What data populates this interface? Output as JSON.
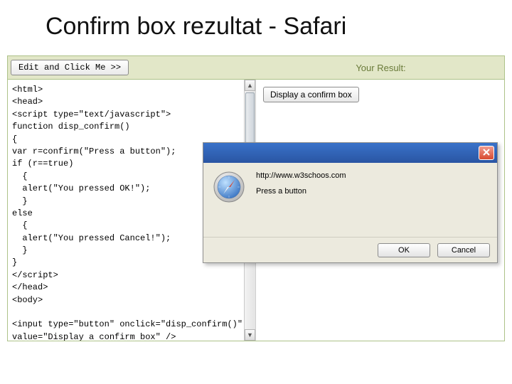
{
  "title": "Confirm box rezultat - Safari",
  "topbar": {
    "edit_label": "Edit and Click Me >>",
    "result_label": "Your Result:"
  },
  "code": "<html>\n<head>\n<script type=\"text/javascript\">\nfunction disp_confirm()\n{\nvar r=confirm(\"Press a button\");\nif (r==true)\n  {\n  alert(\"You pressed OK!\");\n  }\nelse\n  {\n  alert(\"You pressed Cancel!\");\n  }\n}\n</script>\n</head>\n<body>\n\n<input type=\"button\" onclick=\"disp_confirm()\"\nvalue=\"Display a confirm box\" />\n\n</body>\n</html>",
  "result": {
    "display_button": "Display a confirm box"
  },
  "dialog": {
    "host": "http://www.w3schoos.com",
    "message": "Press a button",
    "ok": "OK",
    "cancel": "Cancel"
  },
  "scrollbar": {
    "up": "▲",
    "down": "▼"
  }
}
